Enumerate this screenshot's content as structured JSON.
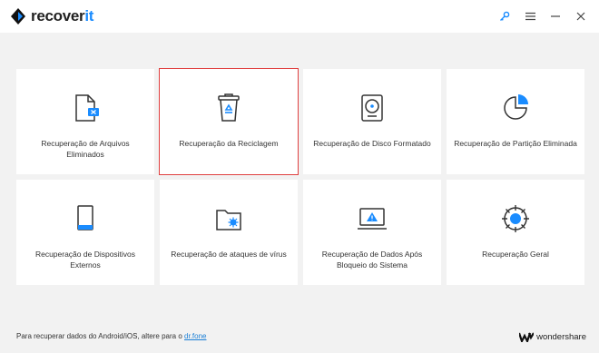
{
  "app": {
    "logo_main": "recover",
    "logo_accent": "it"
  },
  "window_controls": [
    {
      "name": "settings-key-icon"
    },
    {
      "name": "menu-icon"
    },
    {
      "name": "minimize-icon"
    },
    {
      "name": "close-icon"
    }
  ],
  "cards": [
    {
      "label": "Recuperação de Arquivos Eliminados",
      "icon": "deleted-file-icon",
      "selected": false
    },
    {
      "label": "Recuperação da Reciclagem",
      "icon": "recycle-bin-icon",
      "selected": true
    },
    {
      "label": "Recuperação de Disco Formatado",
      "icon": "hard-disk-icon",
      "selected": false
    },
    {
      "label": "Recuperação de Partição Eliminada",
      "icon": "partition-icon",
      "selected": false
    },
    {
      "label": "Recuperação de Dispositivos Externos",
      "icon": "external-device-icon",
      "selected": false
    },
    {
      "label": "Recuperação de ataques de vírus",
      "icon": "virus-folder-icon",
      "selected": false
    },
    {
      "label": "Recuperação de Dados Após Bloqueio do Sistema",
      "icon": "crash-computer-icon",
      "selected": false
    },
    {
      "label": "Recuperação Geral",
      "icon": "all-around-icon",
      "selected": false
    }
  ],
  "footer": {
    "text": "Para recuperar dados do Android/iOS, altere para o",
    "link": "dr.fone"
  },
  "brand": {
    "name": "wondershare"
  },
  "colors": {
    "accent": "#1a8cff",
    "selected_border": "#e04040",
    "background": "#f2f2f2"
  }
}
